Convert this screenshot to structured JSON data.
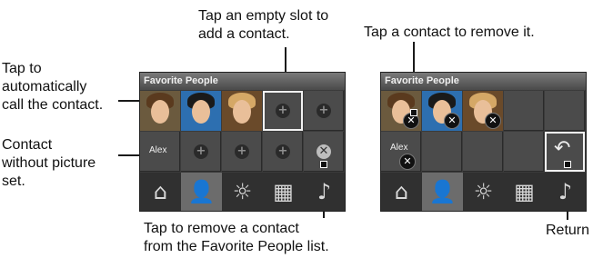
{
  "callouts": {
    "tap_empty_slot": "Tap an empty slot to\nadd a contact.",
    "tap_contact_remove": "Tap a contact to remove it.",
    "tap_call": "Tap to\nautomatically\ncall the contact.",
    "contact_no_picture": "Contact\nwithout picture\nset.",
    "tap_remove_list": "Tap to remove a contact\nfrom the Favorite People list.",
    "return": "Return"
  },
  "panel_left": {
    "title": "Favorite People",
    "contact_label": "Alex",
    "plus_glyph": "+",
    "remove_glyph": "✕"
  },
  "panel_right": {
    "title": "Favorite People",
    "contact_label": "Alex",
    "remove_glyph": "✕",
    "return_glyph": "↶"
  },
  "tabs": [
    {
      "icon": "home-icon",
      "glyph": "⌂"
    },
    {
      "icon": "people-icon",
      "glyph": "👤"
    },
    {
      "icon": "weather-icon",
      "glyph": "☼"
    },
    {
      "icon": "apps-grid-icon",
      "glyph": "▦"
    },
    {
      "icon": "music-icon",
      "glyph": "♪"
    }
  ],
  "colors": {
    "panel_bg": "#3b3b3b",
    "title_bg": "#6a6a6a",
    "selection_border": "#f2f2f2"
  }
}
